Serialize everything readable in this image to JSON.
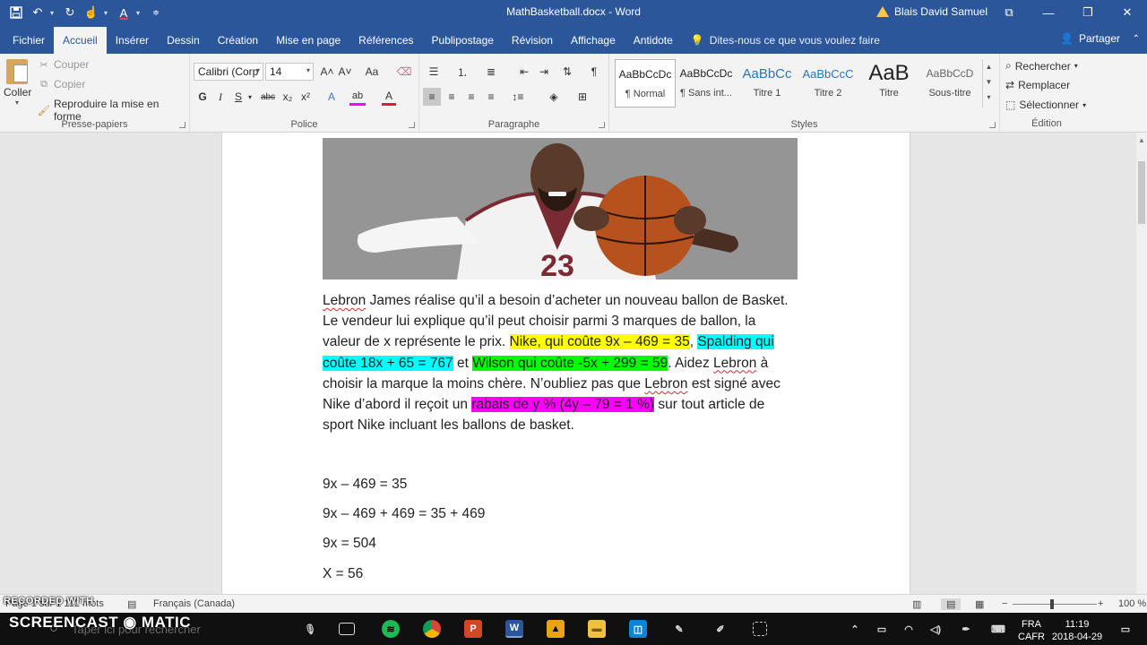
{
  "window": {
    "doc_title": "MathBasketball.docx - Word",
    "user": "Blais David Samuel",
    "controls": [
      "⧉",
      "—",
      "❐",
      "✕"
    ]
  },
  "tabs": [
    "Fichier",
    "Accueil",
    "Insérer",
    "Dessin",
    "Création",
    "Mise en page",
    "Références",
    "Publipostage",
    "Révision",
    "Affichage",
    "Antidote"
  ],
  "tell_me": "Dites-nous ce que vous voulez faire",
  "share": "Partager",
  "ribbon": {
    "clipboard": {
      "paste": "Coller",
      "cut": "Couper",
      "copy": "Copier",
      "format_painter": "Reproduire la mise en forme",
      "label": "Presse-papiers"
    },
    "font": {
      "family": "Calibri (Corp",
      "size": "14",
      "label": "Police",
      "bold": "G",
      "italic": "I",
      "underline": "S",
      "strike": "abc",
      "subscript": "x₂",
      "superscript": "x²",
      "grow": "A˄",
      "shrink": "A˅",
      "case": "Aa",
      "effects": "A",
      "highlight": "ab",
      "color": "A"
    },
    "paragraph": {
      "label": "Paragraphe"
    },
    "styles": {
      "label": "Styles",
      "items": [
        {
          "preview": "AaBbCcDc",
          "name": "¶ Normal"
        },
        {
          "preview": "AaBbCcDc",
          "name": "¶ Sans int..."
        },
        {
          "preview": "AaBbCc",
          "name": "Titre 1"
        },
        {
          "preview": "AaBbCcC",
          "name": "Titre 2"
        },
        {
          "preview": "AaB",
          "name": "Titre"
        },
        {
          "preview": "AaBbCcD",
          "name": "Sous-titre"
        }
      ]
    },
    "editing": {
      "label": "Édition",
      "find": "Rechercher",
      "replace": "Remplacer",
      "select": "Sélectionner"
    }
  },
  "document": {
    "image_alt": "Basketball player holding a basketball, jersey 23",
    "jersey_number": "23",
    "paragraph": {
      "l1_a": "Lebron",
      "l1_b": " James réalise qu’il a besoin d’acheter un nouveau ballon de Basket.",
      "l2": "Le vendeur lui explique qu’il peut choisir parmi 3 marques de ballon, la",
      "l3_a": "valeur de x représente le prix. ",
      "l3_nike": "Nike, qui coûte 9x – 469 = 35",
      "l3_b": ", ",
      "l3_spalding": "Spalding qui",
      "l4_spalding": "coûte 18x + 65 = 767",
      "l4_b": " et ",
      "l4_wilson": "Wilson qui coûte -5x + 299 = 59",
      "l4_c": ". Aidez ",
      "l4_lebron": "Lebron",
      "l4_d": " à",
      "l5_a": "choisir la marque la moins chère. N’oubliez pas que ",
      "l5_lebron": "Lebron",
      "l5_b": " est signé avec",
      "l6_a": "Nike d’abord il reçoit un ",
      "l6_rabais": "rabais de y % (4y – 79 = 1 %)",
      "l6_b": " sur tout article de",
      "l7": "sport Nike incluant les ballons de basket."
    },
    "equations": [
      "9x – 469 = 35",
      "9x – 469 + 469 = 35 + 469",
      "9x = 504",
      "X = 56"
    ]
  },
  "statusbar": {
    "words": "Page 1 sur 1   112 mots",
    "language": "Français (Canada)",
    "zoom": "100 %"
  },
  "taskbar": {
    "search_placeholder": "Taper ici pour rechercher",
    "lang_top": "FRA",
    "lang_bottom": "CAFR",
    "time": "11:19",
    "date": "2018-04-29"
  },
  "watermark": {
    "recorded": "RECORDED WITH",
    "brand": "SCREENCAST ◉ MATIC"
  },
  "colors": {
    "word_blue": "#2b579a",
    "highlight_yellow": "#ffff00",
    "highlight_cyan": "#00ffff",
    "highlight_green": "#00ff00",
    "highlight_magenta": "#ff00ff"
  }
}
